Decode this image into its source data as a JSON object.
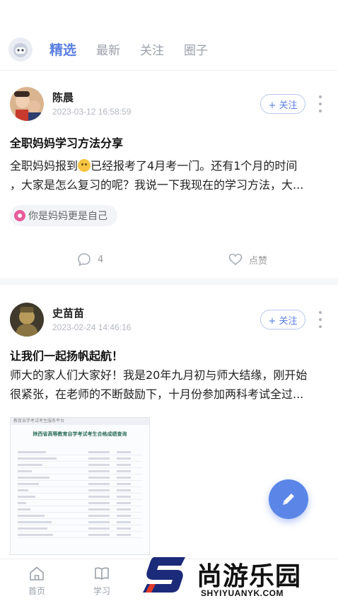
{
  "top_tabs": [
    "精选",
    "最新",
    "关注",
    "圈子"
  ],
  "posts": [
    {
      "author": "陈晨",
      "time": "2023-03-12 16:58:59",
      "follow_label": "+ 关注",
      "title": "全职妈妈学习方法分享",
      "body_line1_a": "全职妈妈报到",
      "body_line1_b": "已经报考了4月考一门。还有1个月的时间",
      "body_line2": "，大家是怎么复习的呢？我说一下我现在的学习方法，大...",
      "topic": "你是妈妈更是自己",
      "comments": "4",
      "like_label": "点赞"
    },
    {
      "author": "史苗苗",
      "time": "2023-02-24 14:46:16",
      "follow_label": "+ 关注",
      "title": "让我们一起扬帆起航！",
      "body_line1": "师大的家人们大家好！我是20年九月初与师大结缘，刚开始",
      "body_line2": "很紧张，在老师的不断鼓励下，十月份参加两科考试全过...",
      "thumb_head": "教育自学考试考生服务平台",
      "thumb_banner": "陕西省高等教育自学考试考生合格成绩查询"
    }
  ],
  "bottom_nav": {
    "home": "首页",
    "study": "学习"
  },
  "watermark": {
    "text": "尚游乐园",
    "url": "SHYIYUANYK.COM"
  },
  "colors": {
    "accent": "#5a7fe0",
    "fab": "#5b86e8"
  }
}
